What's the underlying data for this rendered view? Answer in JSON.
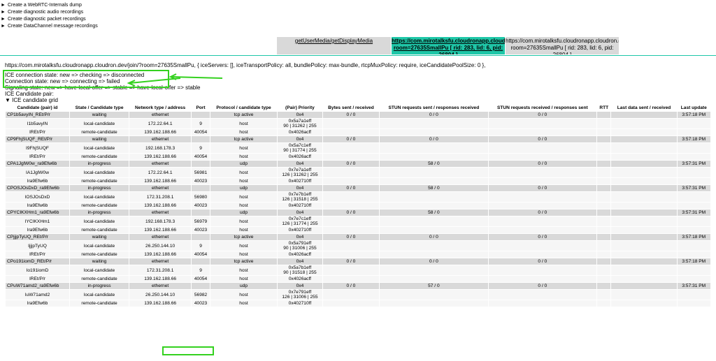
{
  "summaries": [
    "Create a WebRTC-Internals dump",
    "Create diagnostic audio recordings",
    "Create diagnostic packet recordings",
    "Create DataChannel message recordings"
  ],
  "tabs": {
    "gum": "getUserMedia/getDisplayMedia",
    "selected": "https://com.mirotalksfu.cloudronapp.cloudron.dev/join/?room=27635SmallPu [ rid: 283, lid: 6, pid: 26804 ]",
    "other": "https://com.mirotalksfu.cloudronapp.cloudron.dev/join/?room=27635SmallPu [ rid: 283, lid: 6, pid: 26804 ]"
  },
  "info": {
    "config": "https://com.mirotalksfu.cloudronapp.cloudron.dev/join/?room=27635SmallPu, { iceServers: [], iceTransportPolicy: all, bundlePolicy: max-bundle, rtcpMuxPolicy: require, iceCandidatePoolSize: 0 },",
    "ice_state": "ICE connection state: new => checking => disconnected",
    "conn_state": "Connection state: new => connecting => failed",
    "signaling_state": "Signaling state: new => have-local-offer => stable => have-local-offer => stable",
    "candidate_pair": "ICE Candidate pair:",
    "grid_toggle": "ICE candidate grid"
  },
  "highlight_color": "#34d11f",
  "accent_color": "#1fc7a8",
  "grid": {
    "headers": [
      "Candidate (pair) id",
      "State / Candidate type",
      "Network type / address",
      "Port",
      "Protocol / candidate type",
      "(Pair) Priority",
      "Bytes sent / received",
      "STUN requests sent / responses received",
      "STUN requests received / responses sent",
      "RTT",
      "Last data sent / received",
      "Last update"
    ],
    "groups": [
      {
        "pair": [
          "CP1b5avyIN_REt/P/r",
          "waiting",
          "ethernet",
          "",
          "tcp active",
          "0x4",
          "0 / 0",
          "0 / 0",
          "0 / 0",
          "",
          "",
          "3:57:18 PM"
        ],
        "local": [
          "I1b5avyIN",
          "local-candidate",
          "172.22.64.1",
          "9",
          "host",
          "0x5a7a1eff",
          "90 | 31262 | 255"
        ],
        "remote": [
          "IREt/P/r",
          "remote-candidate",
          "139.162.188.66",
          "40054",
          "host",
          "0x4026acff"
        ]
      },
      {
        "pair": [
          "CP9FhjSUQF_REt/P/r",
          "waiting",
          "ethernet",
          "",
          "tcp active",
          "0x4",
          "0 / 0",
          "0 / 0",
          "0 / 0",
          "",
          "",
          "3:57:18 PM"
        ],
        "local": [
          "I9FhjSUQF",
          "local-candidate",
          "192.168.178.3",
          "9",
          "host",
          "0x5a7c1eff",
          "90 | 31774 | 255"
        ],
        "remote": [
          "IREt/P/r",
          "remote-candidate",
          "139.162.188.66",
          "40054",
          "host",
          "0x4026acff"
        ]
      },
      {
        "pair": [
          "CPA1JglW0w_ra9Efw6b",
          "in-progress",
          "ethernet",
          "",
          "udp",
          "0x4",
          "0 / 0",
          "58 / 0",
          "0 / 0",
          "",
          "",
          "3:57:31 PM"
        ],
        "local": [
          "IA1JglW0w",
          "local-candidate",
          "172.22.64.1",
          "56981",
          "host",
          "0x7e7a1eff",
          "126 | 31262 | 255"
        ],
        "remote": [
          "Ira9Efw6b",
          "remote-candidate",
          "139.162.188.66",
          "40023",
          "host",
          "0x402710ff"
        ]
      },
      {
        "pair": [
          "CPOSJOsDxD_ra9Efw6b",
          "in-progress",
          "ethernet",
          "",
          "udp",
          "0x4",
          "0 / 0",
          "58 / 0",
          "0 / 0",
          "",
          "",
          "3:57:31 PM"
        ],
        "local": [
          "IOSJOsDxD",
          "local-candidate",
          "172.31.208.1",
          "56980",
          "host",
          "0x7e7b1eff",
          "126 | 31518 | 255"
        ],
        "remote": [
          "Ira9Efw6b",
          "remote-candidate",
          "139.162.188.66",
          "40023",
          "host",
          "0x402710ff"
        ]
      },
      {
        "pair": [
          "CPYCIKXHm1_ra9Efw6b",
          "in-progress",
          "ethernet",
          "",
          "udp",
          "0x4",
          "0 / 0",
          "58 / 0",
          "0 / 0",
          "",
          "",
          "3:57:31 PM"
        ],
        "local": [
          "IYCIKXHm1",
          "local-candidate",
          "192.168.178.3",
          "56979",
          "host",
          "0x7e7c1eff",
          "126 | 31774 | 255"
        ],
        "remote": [
          "Ira9Efw6b",
          "remote-candidate",
          "139.162.188.66",
          "40023",
          "host",
          "0x402710ff"
        ]
      },
      {
        "pair": [
          "CPjjjpTyUQ_REt/P/r",
          "waiting",
          "ethernet",
          "",
          "tcp active",
          "0x4",
          "0 / 0",
          "0 / 0",
          "0 / 0",
          "",
          "",
          "3:57:18 PM"
        ],
        "local": [
          "IjjjpTyUQ",
          "local-candidate",
          "26.250.144.10",
          "9",
          "host",
          "0x5a791eff",
          "90 | 31006 | 255"
        ],
        "remote": [
          "IREt/P/r",
          "remote-candidate",
          "139.162.188.66",
          "40054",
          "host",
          "0x4026acff"
        ]
      },
      {
        "pair": [
          "CPo191iomD_REt/P/r",
          "waiting",
          "ethernet",
          "",
          "tcp active",
          "0x4",
          "0 / 0",
          "0 / 0",
          "0 / 0",
          "",
          "",
          "3:57:18 PM"
        ],
        "local": [
          "Io191iomD",
          "local-candidate",
          "172.31.208.1",
          "9",
          "host",
          "0x5a7b1eff",
          "90 | 31518 | 255"
        ],
        "remote": [
          "IREt/P/r",
          "remote-candidate",
          "139.162.188.66",
          "40054",
          "host",
          "0x4026acff"
        ]
      },
      {
        "pair": [
          "CPuW71amd2_ra9Efw6b",
          "in-progress",
          "ethernet",
          "",
          "udp",
          "0x4",
          "0 / 0",
          "57 / 0",
          "0 / 0",
          "",
          "",
          "3:57:31 PM"
        ],
        "local": [
          "IuW71amd2",
          "local-candidate",
          "26.250.144.10",
          "56982",
          "host",
          "0x7e791eff",
          "126 | 31006 | 255"
        ],
        "remote": [
          "Ira9Efw6b",
          "remote-candidate",
          "139.162.188.66",
          "40023",
          "host",
          "0x402710ff"
        ]
      }
    ]
  }
}
